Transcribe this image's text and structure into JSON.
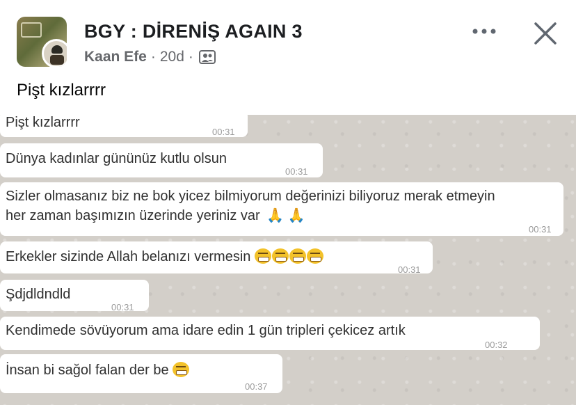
{
  "post": {
    "group_name": "BGY : DİRENİŞ AGAIN 3",
    "author": "Kaan Efe",
    "time": "20d",
    "separator": "·",
    "audience_icon": "group-audience-icon",
    "text": "Pişt kızlarrrr"
  },
  "controls": {
    "more_icon": "more-options-icon",
    "close_icon": "close-icon"
  },
  "colors": {
    "chat_background": "#d3cfc9",
    "bubble": "#ffffff",
    "time": "#9a9a9a",
    "title": "#1c1e21",
    "meta": "#65676b"
  },
  "chat": {
    "messages": [
      {
        "text": "Pişt kızlarrrr",
        "time": "00:31"
      },
      {
        "text": "Dünya kadınlar gününüz kutlu olsun",
        "time": "00:31"
      },
      {
        "text_line1": "Sizler olmasanız biz ne bok yicez bilmiyorum değerinizi biliyoruz merak etmeyin",
        "text_line2": "her zaman başımızın üzerinde yeriniz var",
        "emoji": "folded-hands-emoji",
        "time": "00:31"
      },
      {
        "text": "Erkekler sizinde Allah belanızı vermesin",
        "emoji": "grinning-face-emoji",
        "time": "00:31"
      },
      {
        "text": "Şdjdldndld",
        "time": "00:31"
      },
      {
        "text": "Kendimede sövüyorum ama idare edin 1 gün tripleri çekicez artık",
        "time": "00:32"
      },
      {
        "text": "İnsan bi sağol falan der be",
        "emoji": "grinning-face-emoji",
        "time": "00:37"
      }
    ]
  }
}
